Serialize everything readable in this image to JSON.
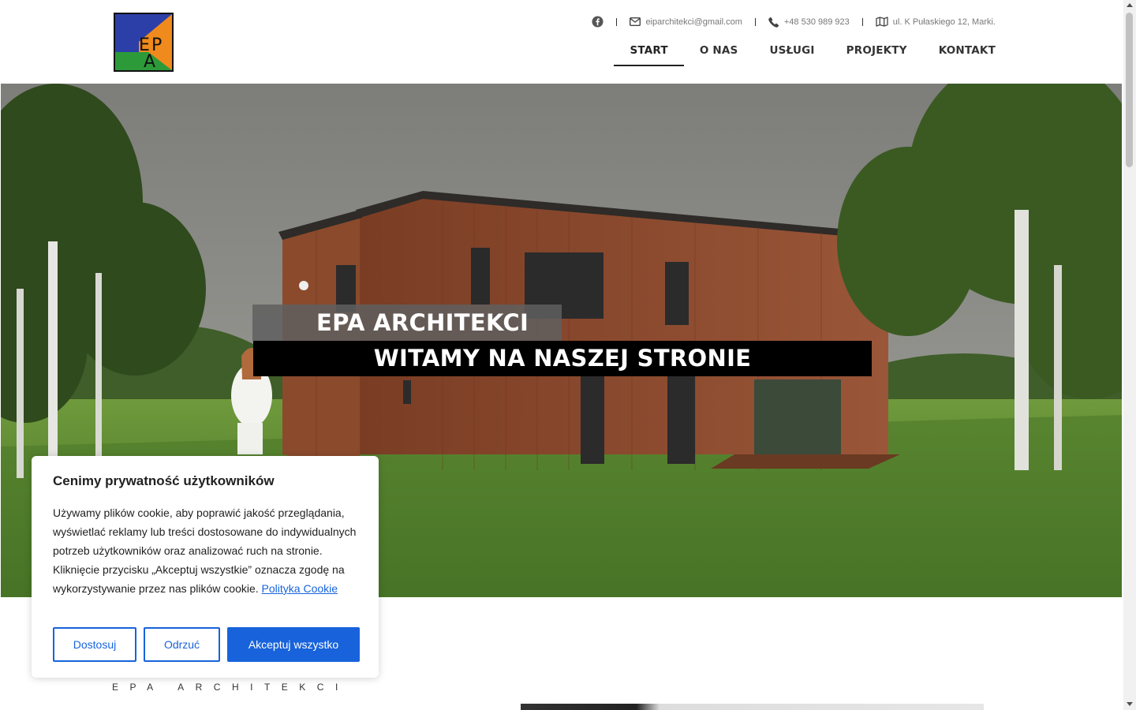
{
  "header": {
    "contacts": {
      "email": "eiparchitekci@gmail.com",
      "phone": "+48 530 989 923",
      "address": "ul. K Pułaskiego 12, Marki."
    },
    "nav": [
      "START",
      "O NAS",
      "USŁUGI",
      "PROJEKTY",
      "KONTAKT"
    ],
    "active_nav": "START"
  },
  "hero": {
    "title": "EPA ARCHITEKCI",
    "subtitle": "WITAMY NA NASZEJ STRONIE"
  },
  "section": {
    "label": "EPA ARCHITEKCI"
  },
  "cookie": {
    "title": "Cenimy prywatność użytkowników",
    "text": "Używamy plików cookie, aby poprawić jakość przeglądania, wyświetlać reklamy lub treści dostosowane do indywidualnych potrzeb użytkowników oraz analizować ruch na stronie. Kliknięcie przycisku „Akceptuj wszystkie” oznacza zgodę na wykorzystywanie przez nas plików cookie.",
    "policy_link": "Polityka Cookie",
    "buttons": {
      "customize": "Dostosuj",
      "reject": "Odrzuć",
      "accept": "Akceptuj wszystko"
    }
  },
  "colors": {
    "accent": "#1863dc",
    "logo_blue": "#2c3fa8",
    "logo_orange": "#f08a1c",
    "logo_green": "#2d9a3a"
  },
  "logo_letters": "EPA"
}
